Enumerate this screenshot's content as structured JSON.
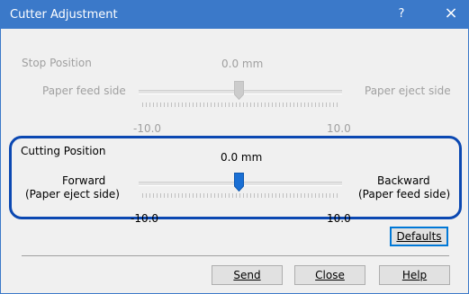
{
  "window": {
    "title": "Cutter Adjustment",
    "help_glyph": "?",
    "close_glyph": "×"
  },
  "stop_position": {
    "label": "Stop Position",
    "value": "0.0 mm",
    "left_label": "Paper feed side",
    "right_label": "Paper eject side",
    "min": "-10.0",
    "max": "10.0",
    "slider_fraction": 0.5,
    "enabled": false
  },
  "cutting_position": {
    "label": "Cutting Position",
    "value": "0.0 mm",
    "left_label_line1": "Forward",
    "left_label_line2": "(Paper eject side)",
    "right_label_line1": "Backward",
    "right_label_line2": "(Paper feed side)",
    "min": "-10.0",
    "max": "10.0",
    "slider_fraction": 0.5,
    "enabled": true
  },
  "buttons": {
    "defaults": "Defaults",
    "send": "Send",
    "close": "Close",
    "help": "Help"
  },
  "colors": {
    "titlebar": "#3b79c9",
    "highlight_outline": "#0b48b2",
    "active_thumb": "#1a6fd4"
  }
}
